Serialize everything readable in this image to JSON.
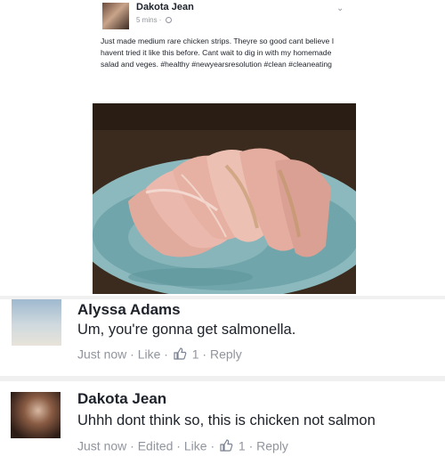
{
  "post": {
    "author": "Dakota Jean",
    "time": "5 mins",
    "text": "Just made medium rare chicken strips. Theyre so good cant believe I havent tried it like this before. Cant wait to dig in with my homemade salad and veges. #healthy #newyearsresolution #clean #cleaneating",
    "menu_icon": "chevron-down-icon",
    "privacy_icon": "globe-icon"
  },
  "comments": [
    {
      "author": "Alyssa Adams",
      "text": "Um, you're gonna get salmonella.",
      "time": "Just now",
      "like_label": "Like",
      "like_count": "1",
      "reply_label": "Reply",
      "sep": "·"
    },
    {
      "author": "Dakota Jean",
      "text": "Uhhh dont think so, this is chicken not salmon",
      "time": "Just now",
      "edited_label": "Edited",
      "like_label": "Like",
      "like_count": "1",
      "reply_label": "Reply",
      "sep": "·"
    }
  ],
  "colors": {
    "meta_text": "#90949c",
    "plate": "#7fb3b8",
    "chicken": "#e3b1a4"
  }
}
